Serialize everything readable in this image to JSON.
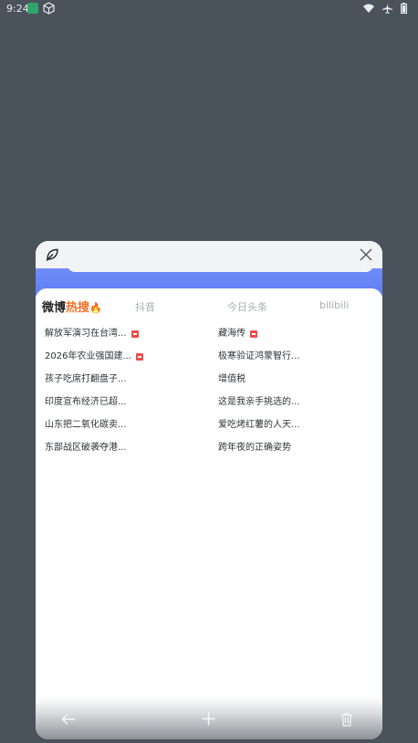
{
  "status_bar": {
    "time": "9:24"
  },
  "tabs": {
    "weibo_part1": "微博",
    "weibo_part2": "热搜",
    "douyin": "抖音",
    "toutiao": "今日头条",
    "bilibili": "bilibili"
  },
  "news": {
    "left": [
      {
        "text": "解放军演习在台湾...",
        "badge": true
      },
      {
        "text": "2026年农业强国建...",
        "badge": true
      },
      {
        "text": "孩子吃席打翻盘子...",
        "badge": false
      },
      {
        "text": "印度宣布经济已超...",
        "badge": false
      },
      {
        "text": "山东把二氧化碳卖...",
        "badge": false
      },
      {
        "text": "东部战区破袭夺港...",
        "badge": false
      }
    ],
    "right": [
      {
        "text": "藏海传",
        "badge": true
      },
      {
        "text": "极寒验证鸿蒙智行...",
        "badge": false
      },
      {
        "text": "增值税",
        "badge": false
      },
      {
        "text": "这是我亲手挑选的...",
        "badge": false
      },
      {
        "text": "爱吃烤红薯的人天...",
        "badge": false
      },
      {
        "text": "跨年夜的正确姿势",
        "badge": false
      }
    ]
  },
  "colors": {
    "backdrop": "#4a535b",
    "band_blue": "#6f8df7",
    "badge_red": "#ef4b4b",
    "hot_orange": "#f5702c"
  }
}
